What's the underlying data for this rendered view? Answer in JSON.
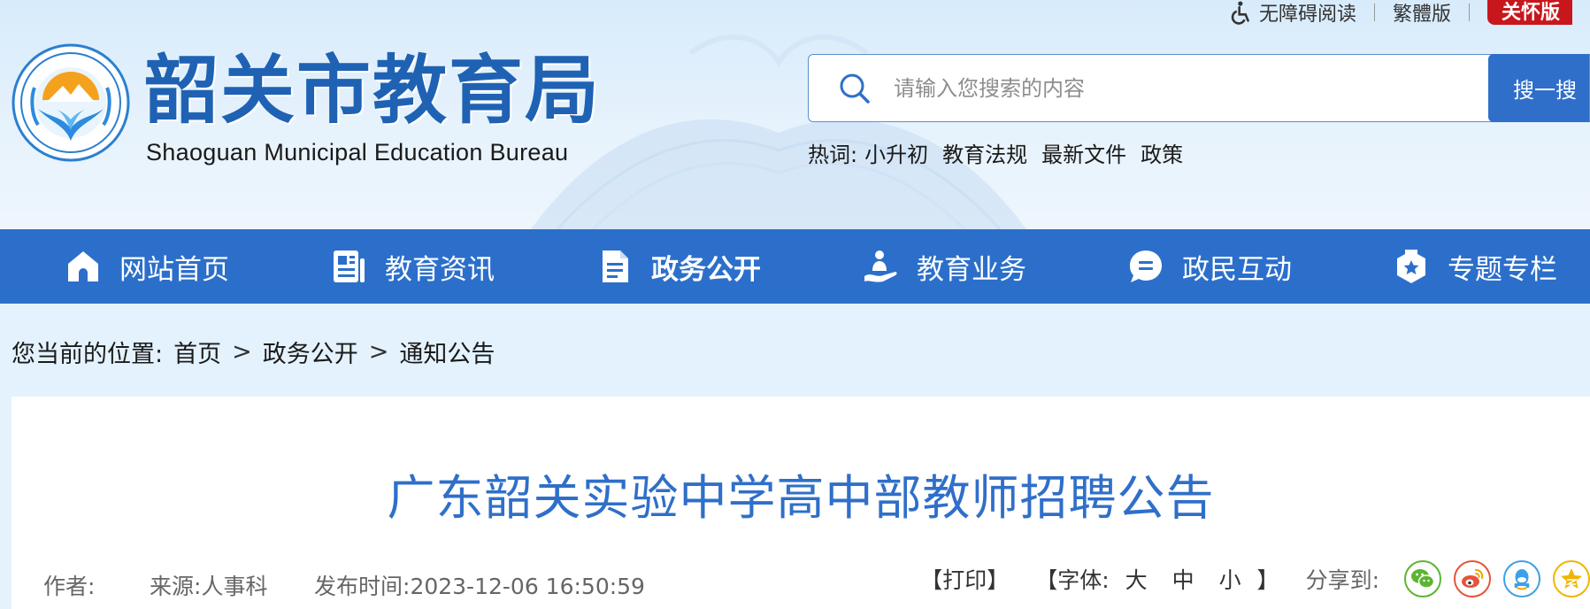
{
  "topbar": {
    "accessibility_label": "无障碍阅读",
    "traditional_label": "繁體版",
    "care_label": "关怀版"
  },
  "site": {
    "name_cn": "韶关市教育局",
    "name_en": "Shaoguan Municipal Education Bureau"
  },
  "search": {
    "placeholder": "请输入您搜索的内容",
    "button_label": "搜一搜"
  },
  "hotwords": {
    "label": "热词:",
    "items": [
      "小升初",
      "教育法规",
      "最新文件",
      "政策"
    ]
  },
  "nav": {
    "items": [
      {
        "label": "网站首页",
        "icon": "home-icon"
      },
      {
        "label": "教育资讯",
        "icon": "news-icon"
      },
      {
        "label": "政务公开",
        "icon": "document-icon"
      },
      {
        "label": "教育业务",
        "icon": "service-icon"
      },
      {
        "label": "政民互动",
        "icon": "chat-icon"
      },
      {
        "label": "专题专栏",
        "icon": "badge-star-icon"
      }
    ],
    "active_index": 2
  },
  "breadcrumb": {
    "prefix": "您当前的位置:",
    "items": [
      "首页",
      "政务公开",
      "通知公告"
    ],
    "separator": ">"
  },
  "article": {
    "title": "广东韶关实验中学高中部教师招聘公告",
    "author_label": "作者:",
    "source_label": "来源:",
    "source_value": "人事科",
    "publish_label": "发布时间:",
    "publish_value": "2023-12-06 16:50:59",
    "print_label": "【打印】",
    "font_label": "【字体:",
    "font_large": "大",
    "font_medium": "中",
    "font_small": "小",
    "font_close": "】",
    "share_label": "分享到:"
  },
  "colors": {
    "brand_blue": "#2c6fcb",
    "care_red": "#c8161d",
    "wechat_green": "#5cb531",
    "weibo_red": "#e5533b",
    "qq_blue": "#3ea0e6",
    "qzone_yellow": "#f2b400"
  }
}
